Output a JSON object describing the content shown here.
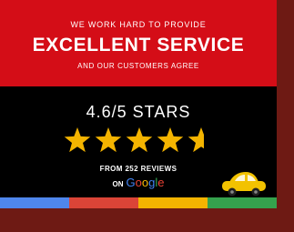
{
  "banner": {
    "tagline_top": "WE WORK HARD TO PROVIDE",
    "headline": "EXCELLENT SERVICE",
    "tagline_bottom": "AND OUR CUSTOMERS AGREE"
  },
  "rating": {
    "text": "4.6/5 STARS",
    "value": 4.6,
    "max": 5,
    "star_color": "#f4b400"
  },
  "reviews": {
    "text": "FROM 252 REVIEWS",
    "on_label": "ON",
    "google_letters": [
      "G",
      "o",
      "o",
      "g",
      "l",
      "e"
    ]
  },
  "colors": {
    "red_panel": "#d40d17",
    "frame": "#6e1a14",
    "stripe": [
      "#4f86ec",
      "#db4437",
      "#f4b400",
      "#35a24d"
    ],
    "car": "#f2c200"
  },
  "icons": {
    "car": "car-icon",
    "star": "star-icon"
  }
}
